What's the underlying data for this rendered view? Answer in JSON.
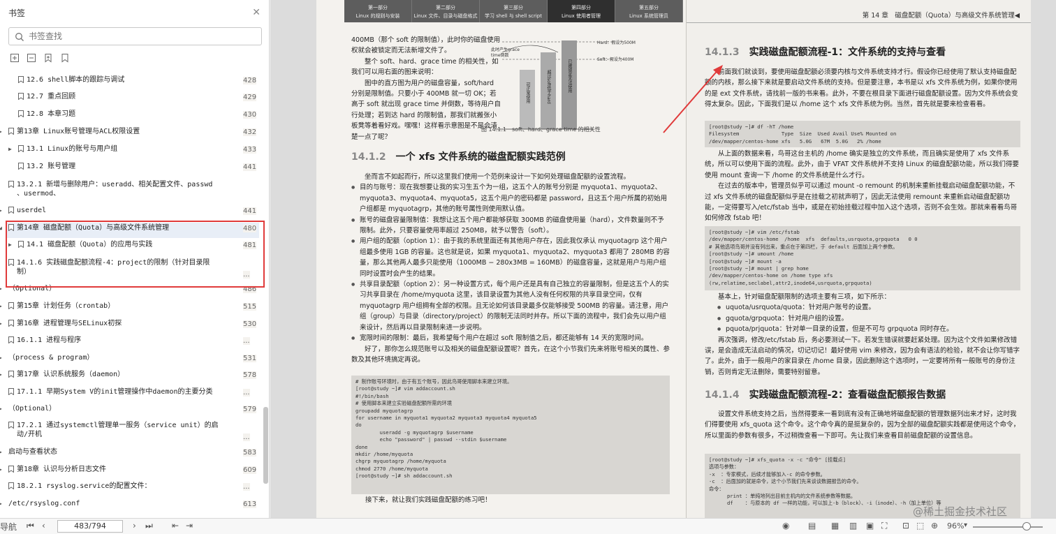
{
  "sidebar": {
    "title": "书签",
    "search_placeholder": "书签查找",
    "items": [
      {
        "label": "12.6 shell脚本的跟踪与调试",
        "page": "428"
      },
      {
        "label": "12.7 重点回顾",
        "page": "429"
      },
      {
        "label": "12.8 本章习题",
        "page": "430"
      },
      {
        "label": "第13章 Linux账号管理与ACL权限设置",
        "page": "432"
      },
      {
        "label": "13.1 Linux的账号与用户组",
        "page": "433"
      },
      {
        "label": "13.2 账号管理",
        "page": "441"
      },
      {
        "label": "13.2.1 新增与删除用户：useradd、相关配置文件、passwd\n、usermod、",
        "page": ""
      },
      {
        "label": "userdel",
        "page": "441"
      },
      {
        "label": "第14章 磁盘配额（Quota）与高级文件系统管理",
        "page": "480"
      },
      {
        "label": "14.1 磁盘配额（Quota）的应用与实践",
        "page": "481"
      },
      {
        "label": "14.1.6 实践磁盘配额流程-4：project的限制（针对目录限\n制）",
        "page": "..."
      },
      {
        "label": "（Optional）",
        "page": "486"
      },
      {
        "label": "第15章 计划任务（crontab）",
        "page": "515"
      },
      {
        "label": "第16章 进程管理与SELinux初探",
        "page": "530"
      },
      {
        "label": "16.1.1 进程与程序",
        "page": "..."
      },
      {
        "label": "（process & program）",
        "page": "531"
      },
      {
        "label": "第17章 认识系统服务（daemon）",
        "page": "578"
      },
      {
        "label": "17.1.1 早期System V的init管理操作中daemon的主要分类",
        "page": "..."
      },
      {
        "label": "（Optional）",
        "page": "579"
      },
      {
        "label": "17.2.1 通过systemctl管理单一服务（service unit）的启\n动/开机",
        "page": "..."
      },
      {
        "label": "启动与查看状态",
        "page": "583"
      },
      {
        "label": "第18章 认识与分析日志文件",
        "page": "609"
      },
      {
        "label": "18.2.1 rsyslog.service的配置文件：",
        "page": "..."
      },
      {
        "label": "/etc/rsyslog.conf",
        "page": "613"
      }
    ]
  },
  "bottombar": {
    "left_label": "导航",
    "page_display": "483/794",
    "zoom": "96%"
  },
  "doc": {
    "tabs": [
      {
        "line1": "第一部分",
        "line2": "Linux 的规则与安装"
      },
      {
        "line1": "第二部分",
        "line2": "Linux 文件、目录与磁盘格式"
      },
      {
        "line1": "第三部分",
        "line2": "学习 shell 与 shell script"
      },
      {
        "line1": "第四部分",
        "line2": "Linux 使用者管理"
      },
      {
        "line1": "第五部分",
        "line2": "Linux 系统管理员"
      }
    ],
    "right_header": "第 14 章　磁盘配额（Quota）与高级文件系统管理◀",
    "left": {
      "p1": "400MB（那个 soft 的限制值），此时你的磁盘使用权就会被锁定而无法新增文件了。",
      "p2": "整个 soft、hard、grace time 的相关性，如我们可以用右面的图来说明：",
      "p3": "图中的直方图为用户的磁盘容量，soft/hard 分别是限制值。只要小于 400MB 就一切 OK；若高于 soft 就出现 grace time 并倒数，等待用户自行处理；若到达 hard 的限制值，那我们就搬张小板凳等着看好戏。嘿嘿！这样看示意图是不是会清楚一点了呢？",
      "fig_caption": "图 14.1.1　soft、hard、grace time 的相关性",
      "fig_hard": "Hard：假设为500M",
      "fig_soft": "Soft：假设为400M",
      "fig_grace": "此时产生grace time倒数",
      "fig_bar1": "可正常使用",
      "fig_bar2": "超过soft低于hard",
      "fig_bar3": "已被锁定无法使用",
      "h_num": "14.1.2",
      "h_title": "一个 xfs 文件系统的磁盘配额实践范例",
      "intro": "坐而言不如起而行，所以这里我们使用一个范例来设计一下如何处理磁盘配额的设置流程。",
      "b1": "目的与账号：现在我想要让我的实习生五个为一组，这五个人的账号分别是 myquota1、myquota2、myquota3、myquota4、myquota5，这五个用户的密码都是 password，且这五个用户所属的初始用户组都是 myquotagrp，其他的账号属性则使用默认值。",
      "b2": "账号的磁盘容量限制值：我想让这五个用户都能够获取 300MB 的磁盘使用量（hard），文件数量则不予限制。此外，只要容量使用率超过 250MB，就予以警告（soft）。",
      "b3": "用户组的配额（option 1）：由于我的系统里面还有其他用户存在，因此我仅承认 myquotagrp 这个用户组最多使用 1GB 的容量。这也就是说，如果 myquota1、myquota2、myquota3 都用了 280MB 的容量，那么其他两人最多只能使用（1000MB − 280x3MB = 160MB）的磁盘容量，这就是用户与用户组同时设置时会产生的结果。",
      "b4": "共享目录配额（option 2）：另一种设置方式，每个用户还是具有自己独立的容量限制，但是这五个人的实习共享目录在 /home/myquota 这里，该目录设置为其他人没有任何权限的共享目录空间，仅有 myquotagrp 用户组拥有全部的权限。且无论如何该目录最多仅能够接受 500MB 的容量。请注意，用户组（group）与目录（directory/project）的限制无法同时并存。所以下面的流程中，我们会先以用户组来设计，然后再以目录限制来进一步说明。",
      "b5": "宽限时间的限制：最后，我希望每个用户在超过 soft 限制值之后，都还能够有 14 天的宽限时间。",
      "p_end": "好了，那你怎么规范账号以及相关的磁盘配额设置呢？首先，在这个小节我们先来将账号相关的属性、参数及其他环境搞定再说。",
      "code": "# 制作账号环境时，由于有五个账号，因此鸟哥使用脚本来建立环境。\n[root@study ~]# vim addaccount.sh\n#!/bin/bash\n# 使用脚本来建立实验磁盘配额所需的环境\ngroupadd myquotagrp\nfor username in myquota1 myquota2 myquota3 myquota4 myquota5\ndo\n        useradd -g myquotagrp $username\n        echo \"password\" | passwd --stdin $username\ndone\nmkdir /home/myquota\nchgrp myquotagrp /home/myquota\nchmod 2770 /home/myquota\n[root@study ~]# sh addaccount.sh",
      "p_last": "接下来，就让我们实践磁盘配额的练习吧！"
    },
    "right": {
      "h1_num": "14.1.3",
      "h1_title": "实践磁盘配额流程-1：文件系统的支持与查看",
      "p1": "前面我们就谈到，要使用磁盘配额必须要内核与文件系统支持才行。假设你已经使用了默认支持磁盘配额的内核，那么接下来就是要启动文件系统的支持。但是要注意，本书是以 xfs 文件系统为例，如果你使用的是 ext 文件系统，请找前一版的书来看。此外，不要在根目录下面进行磁盘配额设置。因为文件系统会变得太复杂。因此，下面我们是以 /home 这个 xfs 文件系统为例。当然，首先就是要来检查看看。",
      "code1": "[root@study ~]# df -hT /home\nFilesystem              Type  Size  Used Avail Use% Mounted on\n/dev/mapper/centos-home xfs   5.0G   67M  5.0G   2% /home",
      "p2": "从上面的数据来看，鸟哥这台主机的 /home 确实是独立的文件系统，而且确实是使用了 xfs 文件系统，所以可以使用下面的流程。此外，由于 VFAT 文件系统并不支持 Linux 的磁盘配额功能，所以我们得要使用 mount 查询一下 /home 的文件系统是什么才行。",
      "p3": "在过去的版本中，管理员似乎可以通过 mount -o remount 的机制来重新挂载启动磁盘配额功能，不过 xfs 文件系统的磁盘配额似乎是在挂载之初就声明了，因此无法使用 remount 来重新启动磁盘配额功能，一定得要写入/etc/fstab 当中，或是在初始挂载过程中加入这个选项，否则不会生效。那就来看看鸟哥如何修改 fstab 吧！",
      "code2": "[root@study ~]# vim /etc/fstab\n/dev/mapper/centos-home  /home  xfs  defaults,usrquota,grpquota   0 0\n# 其他选项鸟哥并没有列出来，重点在于第四栏，于 default 后面加上两个参数。\n[root@study ~]# umount /home\n[root@study ~]# mount -a\n[root@study ~]# mount | grep home\n/dev/mapper/centos-home on /home type xfs\n(rw,relatime,seclabel,attr2,inode64,usrquota,grpquota)",
      "p4": "基本上，针对磁盘配额限制的选项主要有三项，如下所示：",
      "b1": "uquota/usrquota/quota：针对用户账号的设置。",
      "b2": "gquota/grpquota：针对用户组的设置。",
      "b3": "pquota/prjquota：针对单一目录的设置，但是不可与 grpquota 同时存在。",
      "p5": "再次强调，修改/etc/fstab 后，务必要测试一下。若发生错误就要赶紧处理。因为这个文件如果修改错误，是会造成无法启动的情况，切记切记！最好使用 vim 来修改，因为会有语法的检验，就不会让你写错字了。此外，由于一般用户的家目录在 /home 目录，因此删除这个选项时，一定要将所有一般账号的身份注销，否则肯定无法删除，需要特别留意。",
      "h2_num": "14.1.4",
      "h2_title": "实践磁盘配额流程-2：查看磁盘配额报告数据",
      "p6": "设置文件系统支持之后，当然得要来一看到底有没有正确地将磁盘配额的管理数据列出来才好，这时我们得要使用 xfs_quota 这个命令。这个命令真的是挺复杂的，因为全部的磁盘配额实践都是使用这个命令，所以里面的参数有很多，不过稍微查看一下即可。先让我们来查看目前磁盘配额的设置信息。",
      "code3": "[root@study ~]# xfs_quota -x -c \"命令\" [挂载点]\n选项与参数：\n-x  ：专家模式，后续才能够加入-c 的命令参数。\n-c  ：后面加的就是命令，这个小节我们先来谈谈数据报告的命令。\n命令：\n      print ：单纯地列出目前主机内的文件系统参数等数据。\n      df    ：与原本的 df 一样的功能，可以加上-b（block）、-i（inode）、-h（加上单位）等"
    },
    "watermark": "@稀土掘金技术社区"
  }
}
